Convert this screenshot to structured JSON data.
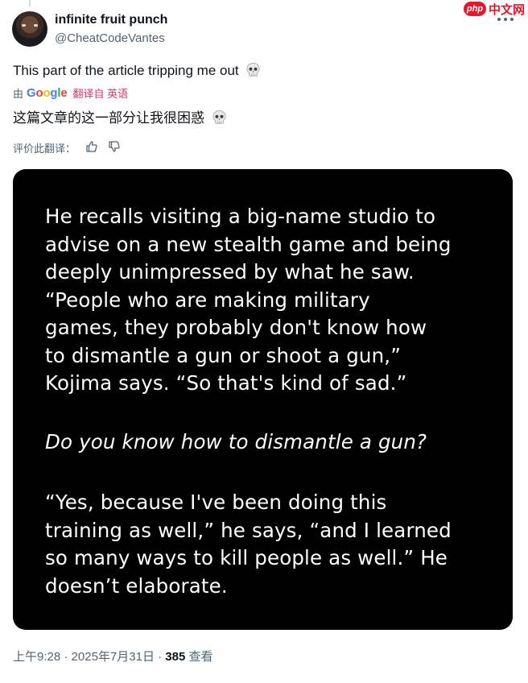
{
  "author": {
    "display_name": "infinite fruit punch",
    "handle": "@CheatCodeVantes"
  },
  "watermark": {
    "badge": "php",
    "site": "中文网"
  },
  "tweet": {
    "text": "This part of the article tripping me out",
    "emoji": "💀"
  },
  "translation": {
    "by_prefix": "由",
    "google": [
      "G",
      "o",
      "o",
      "g",
      "l",
      "e"
    ],
    "google_colors": [
      "#4285F4",
      "#EA4335",
      "#FBBC05",
      "#4285F4",
      "#34A853",
      "#EA4335"
    ],
    "link_text": "翻译自 英语",
    "text": "这篇文章的这一部分让我很困惑",
    "rate_label": "评价此翻译："
  },
  "media": {
    "paragraph1_lines": [
      "He recalls visiting a big-name studio to",
      "advise on a new stealth game and being",
      "deeply unimpressed by what he saw.",
      "“People who are making military",
      "games, they probably don't know how",
      "to dismantle a gun or shoot a gun,”",
      "Kojima says. “So that's kind of sad.”"
    ],
    "paragraph2_lines": [
      "Do you know how to dismantle a gun?"
    ],
    "paragraph3_lines": [
      "“Yes, because I've been doing this",
      "training as well,” he says, “and I learned",
      "so many ways to kill people as well.” He",
      "doesn’t elaborate."
    ]
  },
  "meta": {
    "time": "上午9:28",
    "sep": " · ",
    "date": "2025年7月31日",
    "views_count": "385",
    "views_label": "查看"
  },
  "colors": {
    "text": "#0f1419",
    "muted": "#536471",
    "translate_link": "#d6336c",
    "card_bg": "#000000"
  },
  "icons": [
    "more-horizontal-icon",
    "skull-emoji-icon",
    "thumbs-up-icon",
    "thumbs-down-icon",
    "php-logo-icon"
  ]
}
